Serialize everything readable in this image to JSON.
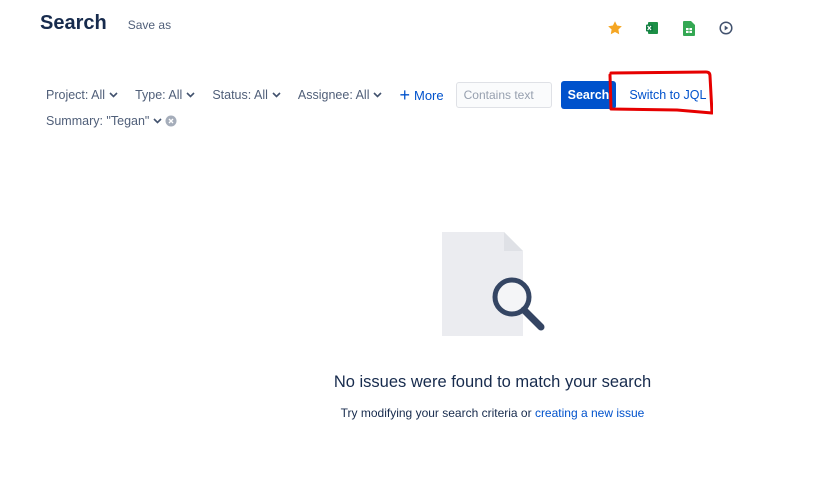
{
  "header": {
    "title": "Search",
    "save_as_label": "Save as",
    "icons": [
      "star-icon",
      "excel-export-icon",
      "sheets-export-icon",
      "play-icon"
    ]
  },
  "filters": {
    "project_label": "Project: All",
    "type_label": "Type: All",
    "status_label": "Status: All",
    "assignee_label": "Assignee: All",
    "more_label": "More",
    "text_placeholder": "Contains text",
    "search_button_label": "Search",
    "switch_jql_label": "Switch to JQL",
    "summary_label": "Summary: \"Tegan\""
  },
  "empty_state": {
    "title": "No issues were found to match your search",
    "subtitle_prefix": "Try modifying your search criteria or ",
    "subtitle_link": "creating a new issue"
  },
  "colors": {
    "accent": "#0052cc",
    "annotation": "#e60000",
    "star": "#f5a623",
    "excel": "#1d8f45",
    "sheets": "#34a853"
  }
}
